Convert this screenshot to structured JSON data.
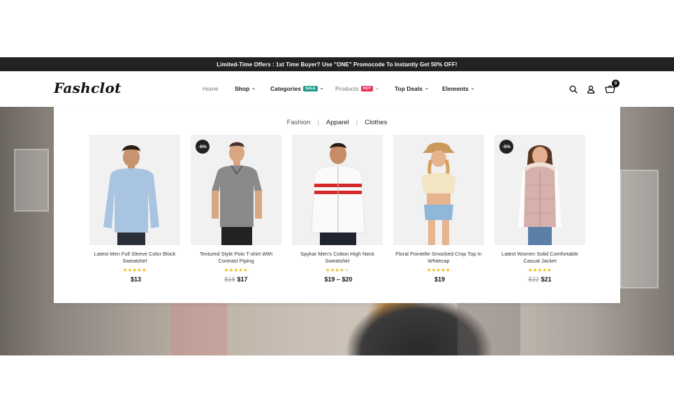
{
  "promo": {
    "text": "Limited-Time Offers : 1st Time Buyer? Use \"ONE\" Promocode To Instantly Get 50% OFF!"
  },
  "brand": {
    "logo": "Fashclot"
  },
  "nav": {
    "home": "Home",
    "shop": "Shop",
    "categories": "Categories",
    "categories_badge": "SALE",
    "products": "Products",
    "products_badge": "HOT",
    "top_deals": "Top Deals",
    "elements": "Elements"
  },
  "header": {
    "cart_count": "0",
    "icons": [
      "search-icon",
      "user-icon",
      "cart-icon"
    ]
  },
  "mega_menu": {
    "crumbs": [
      "Fashion",
      "Apparel",
      "Clothes"
    ],
    "products": [
      {
        "name": "Latest Men Full Sleeve Color Block Sweatshirt",
        "rating": 5,
        "discount": "",
        "old_price": "",
        "price": "$13"
      },
      {
        "name": "Textured Style Polo T-shirt With Contrast Piping",
        "rating": 5,
        "discount": "-6%",
        "old_price": "$18",
        "price": "$17"
      },
      {
        "name": "Spykar Men's Cotton High Neck Sweatshirt",
        "rating": 4,
        "discount": "",
        "old_price": "",
        "price": "$19 – $20"
      },
      {
        "name": "Floral Pointelle Smocked Crop Top In Whitecap",
        "rating": 5,
        "discount": "",
        "old_price": "",
        "price": "$19"
      },
      {
        "name": "Latest Women Solid Comfortable Casual Jacket",
        "rating": 5,
        "discount": "-5%",
        "old_price": "$22",
        "price": "$21"
      }
    ]
  },
  "colors": {
    "promo_bg": "#222222",
    "sale_badge": "#1d9a8a",
    "hot_badge": "#e0305a",
    "star": "#f0b400"
  }
}
